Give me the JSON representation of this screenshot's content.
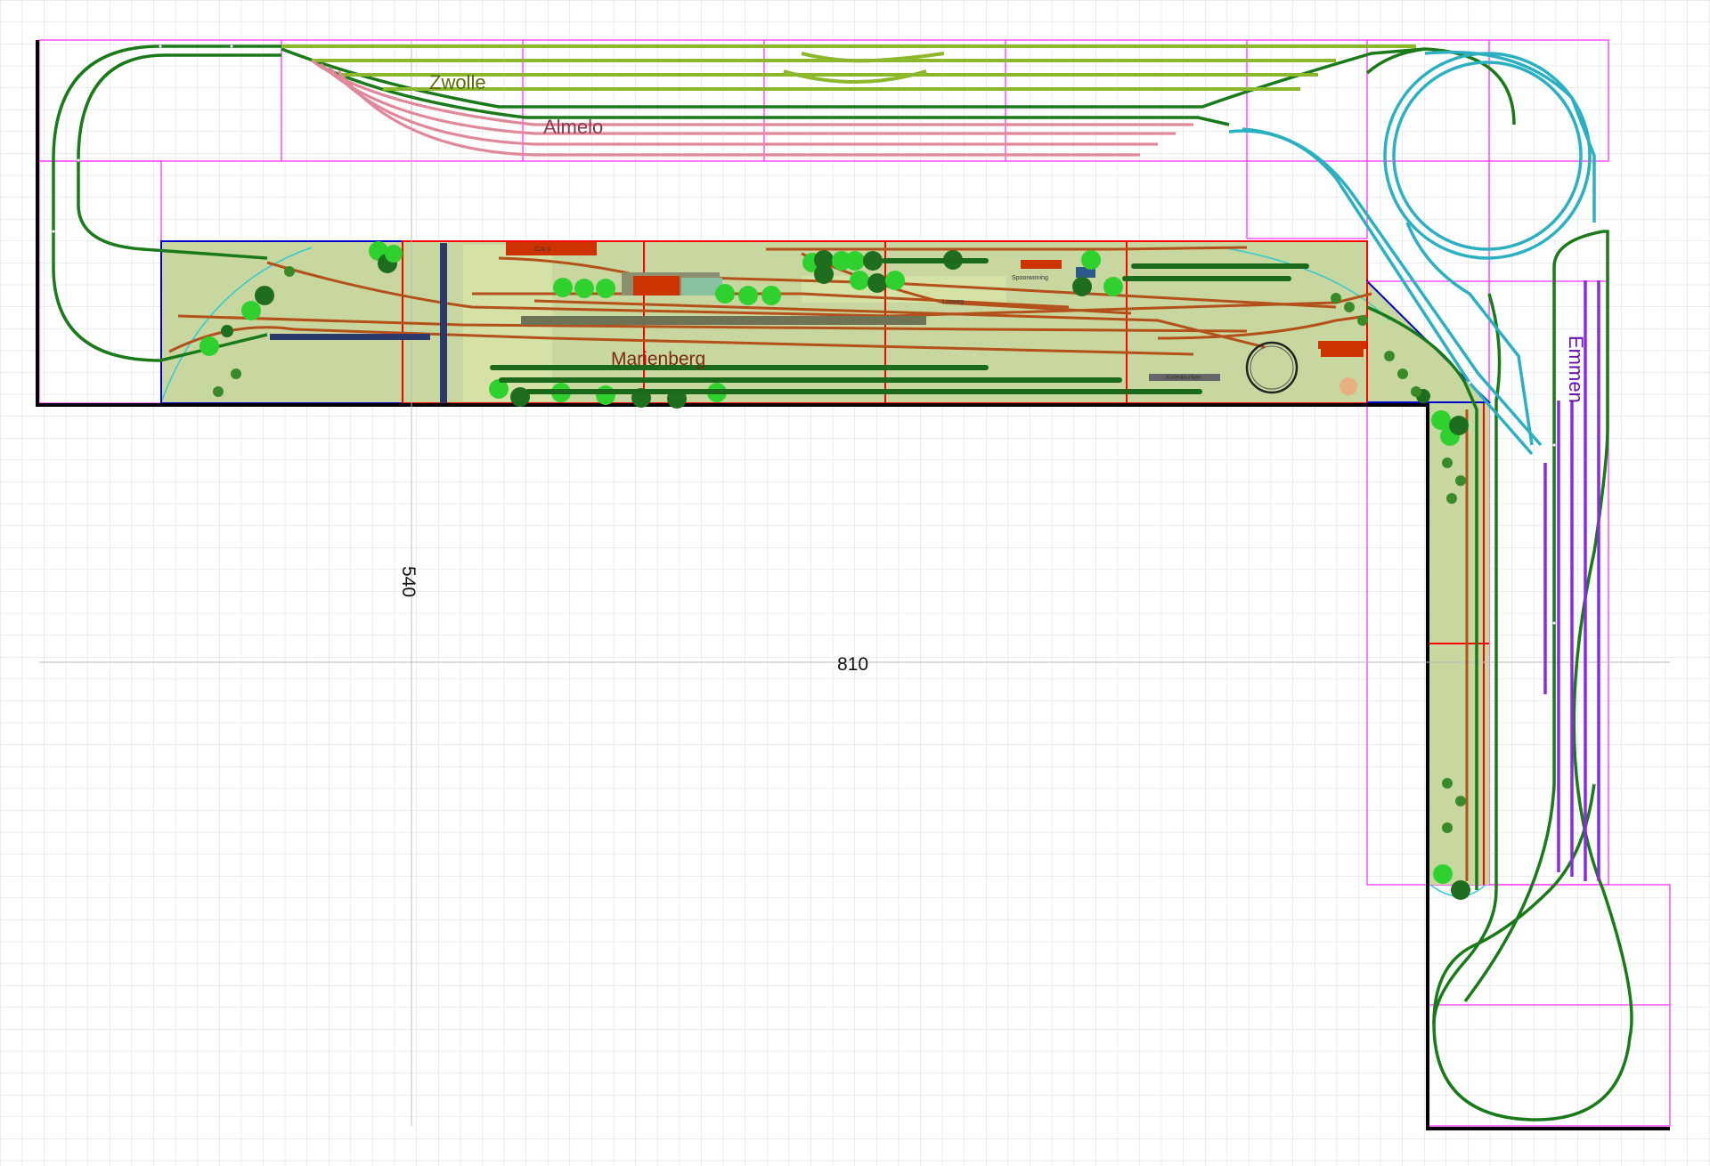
{
  "labels": {
    "zwolle": "Zwolle",
    "almelo": "Almelo",
    "marienberg": "Marienberg",
    "emmen": "Emmen",
    "dim_width": "810",
    "dim_height": "540",
    "cav": "C.A.V.",
    "spoorwoning": "Spoorwoning",
    "losweg": "Losweg",
    "kolenbunker": "Kolenbunker"
  },
  "colors": {
    "grid": "#dcdcdc",
    "frame": "#000000",
    "module_outline": "#ff33ff",
    "module_red": "#ff0000",
    "module_blue": "#0000cc",
    "scenery": "#c8d6a0",
    "track_main": "#1a7a1a",
    "track_light": "#8ab82a",
    "track_pink": "#e0889a",
    "track_cyan": "#2ab0c0",
    "track_purple": "#8a2be2",
    "track_station": "#b4501a",
    "building": "#cc3300",
    "tree_light": "#2ed12e",
    "tree_dark": "#1f6e1f"
  }
}
